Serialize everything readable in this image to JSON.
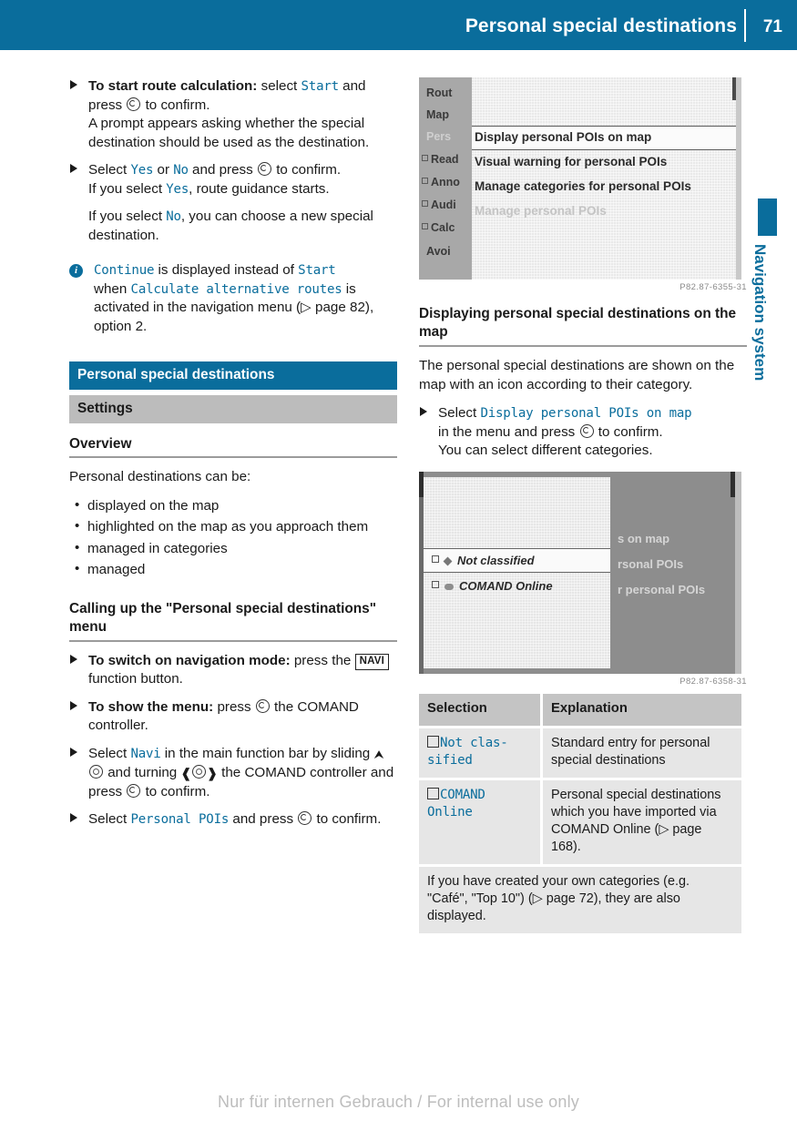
{
  "header": {
    "title": "Personal special destinations",
    "page_number": "71"
  },
  "side_tab": {
    "label": "Navigation system",
    "marker_color": "#0a6d9c"
  },
  "left_column": {
    "step1": {
      "bold": "To start route calculation:",
      "text_a": " select ",
      "mono_start": "Start",
      "text_b": " and press ",
      "text_c": " to confirm.",
      "continuation": "A prompt appears asking whether the special destination should be used as the destination."
    },
    "step2": {
      "text_a": "Select ",
      "mono_yes": "Yes",
      "text_b": " or ",
      "mono_no": "No",
      "text_c": " and press ",
      "text_d": " to confirm.",
      "line2_a": "If you select ",
      "line2_mono": "Yes",
      "line2_b": ", route guidance starts.",
      "line3_a": "If you select ",
      "line3_mono": "No",
      "line3_b": ", you can choose a new special destination."
    },
    "note": {
      "mono_continue": "Continue",
      "text_a": " is displayed instead of ",
      "mono_start": "Start",
      "text_b": " when ",
      "mono_calc": "Calculate alternative routes",
      "text_c": " is activated in the navigation menu (",
      "page_ref": "page 82",
      "text_d": "), option 2."
    },
    "bar_blue": "Personal special destinations",
    "bar_gray": "Settings",
    "h_overview": "Overview",
    "overview_intro": "Personal destinations can be:",
    "overview_bullets": [
      "displayed on the map",
      "highlighted on the map as you approach them",
      "managed in categories",
      "managed"
    ],
    "h_calling": "Calling up the \"Personal special destinations\" menu",
    "step3": {
      "bold": "To switch on navigation mode:",
      "text_a": " press the ",
      "button": "NAVI",
      "text_b": " function button."
    },
    "step4": {
      "bold": "To show the menu:",
      "text_a": " press ",
      "text_b": " the COMAND controller."
    },
    "step5": {
      "text_a": "Select ",
      "mono_navi": "Navi",
      "text_b": " in the main function bar by sliding ",
      "text_c": " and turning ",
      "text_d": " the COMAND controller and press ",
      "text_e": " to confirm."
    },
    "step6": {
      "text_a": "Select ",
      "mono_poi": "Personal POIs",
      "text_b": " and press ",
      "text_c": " to confirm."
    }
  },
  "figure1": {
    "caption": "P82.87-6355-31",
    "sidebar_items": [
      {
        "label": "Rout",
        "checkbox": false,
        "dim": false
      },
      {
        "label": "Map",
        "checkbox": false,
        "dim": false
      },
      {
        "label": "Pers",
        "checkbox": false,
        "dim": true
      },
      {
        "label": "Read",
        "checkbox": true,
        "dim": false
      },
      {
        "label": "Anno",
        "checkbox": true,
        "dim": false
      },
      {
        "label": "Audi",
        "checkbox": true,
        "dim": false
      },
      {
        "label": "Calc",
        "checkbox": true,
        "dim": false
      },
      {
        "label": "Avoi",
        "checkbox": false,
        "dim": false
      }
    ],
    "menu_items": [
      {
        "label": "Display personal POIs on map",
        "highlighted": true,
        "dim": false
      },
      {
        "label": "Visual warning for personal POIs",
        "highlighted": false,
        "dim": false
      },
      {
        "label": "Manage categories for personal POIs",
        "highlighted": false,
        "dim": false
      },
      {
        "label": "Manage personal POIs",
        "highlighted": false,
        "dim": true
      }
    ]
  },
  "right_column": {
    "h_displaying": "Displaying personal special destinations on the map",
    "para1": "The personal special destinations are shown on the map with an icon according to their category.",
    "step1": {
      "text_a": "Select ",
      "mono": "Display personal POIs on map",
      "text_b": " in the menu and press ",
      "text_c": " to confirm.",
      "line2": "You can select different categories."
    }
  },
  "figure2": {
    "caption": "P82.87-6358-31",
    "items": [
      {
        "label": "Not classified",
        "icon": "diamond-icon",
        "highlighted": true
      },
      {
        "label": "COMAND Online",
        "icon": "cloud-icon",
        "highlighted": false
      }
    ],
    "background_text": [
      "s on map",
      "rsonal POIs",
      "r personal POIs"
    ]
  },
  "table": {
    "headers": [
      "Selection",
      "Explanation"
    ],
    "rows": [
      {
        "selection": "Not clas-sified",
        "selection_line1": "Not clas-",
        "selection_line2": "sified",
        "explanation": "Standard entry for personal special destinations"
      },
      {
        "selection": "COMAND Online",
        "selection_line1": "COMAND",
        "selection_line2": "Online",
        "explanation_a": "Personal special destinations which you have imported via COMAND Online (",
        "explanation_page": "page 168",
        "explanation_b": ")."
      }
    ],
    "note_a": "If you have created your own categories (e.g. \"Café\", \"Top 10\") (",
    "note_page": "page 72",
    "note_b": "), they are also displayed."
  },
  "footer": {
    "watermark": "Nur für internen Gebrauch / For internal use only"
  }
}
